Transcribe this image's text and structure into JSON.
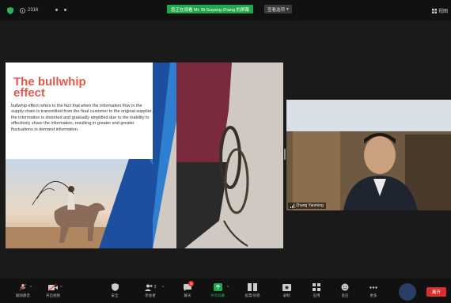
{
  "colors": {
    "share_green": "#20a84a",
    "leave_red": "#d72f2f",
    "title_red": "#e05a4c",
    "slide_blue": "#1d4fa0"
  },
  "topbar": {
    "meeting_id": "2316",
    "share_banner": "您正在观看 Mr. Bi Guyang Zhang 的屏幕",
    "view_options": "查看选项",
    "view_label": "视图"
  },
  "slide": {
    "title": "The bullwhip effect",
    "body": "bullwhip effect refers to the fact that when the information flow in the supply chain is transmitted from the final customer to the original supplier, the information is distorted and gradually amplified due to the inability to effectively share the information, resulting in greater and greater fluctuations in demand information."
  },
  "participant": {
    "name": "Zhang Yanming"
  },
  "toolbar": {
    "items": [
      {
        "key": "mute",
        "label": "解除静音",
        "icon": "microphone-muted-icon"
      },
      {
        "key": "video",
        "label": "开启视频",
        "icon": "video-off-icon"
      },
      {
        "key": "security",
        "label": "安全",
        "icon": "shield-icon"
      },
      {
        "key": "participants",
        "label": "参会者",
        "icon": "participants-icon",
        "count": "2"
      },
      {
        "key": "chat",
        "label": "聊天",
        "icon": "chat-icon",
        "badge": "6"
      },
      {
        "key": "share",
        "label": "共享屏幕",
        "icon": "share-screen-icon"
      },
      {
        "key": "polls",
        "label": "投票/问卷",
        "icon": "polls-icon"
      },
      {
        "key": "record",
        "label": "录制",
        "icon": "record-icon"
      },
      {
        "key": "apps",
        "label": "应用",
        "icon": "apps-icon"
      },
      {
        "key": "reactions",
        "label": "反应",
        "icon": "reactions-icon"
      },
      {
        "key": "more",
        "label": "更多",
        "icon": "more-icon"
      }
    ],
    "leave_label": "离开"
  }
}
